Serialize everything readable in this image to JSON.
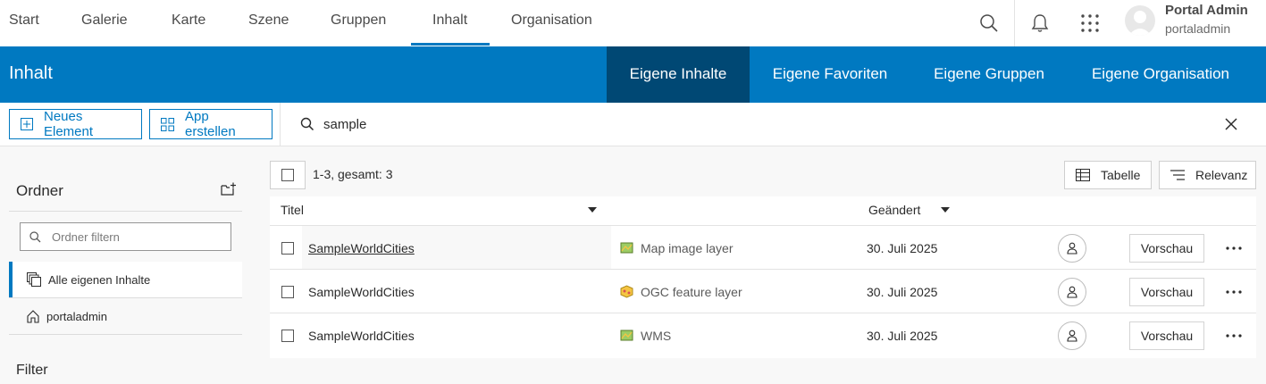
{
  "topnav": {
    "items": [
      "Start",
      "Galerie",
      "Karte",
      "Szene",
      "Gruppen",
      "Inhalt",
      "Organisation"
    ],
    "active": "Inhalt",
    "icons": [
      "search-icon",
      "bell-icon",
      "app-launcher-icon"
    ]
  },
  "user": {
    "name": "Portal Admin",
    "login": "portaladmin"
  },
  "band": {
    "title": "Inhalt",
    "tabs": [
      "Eigene Inhalte",
      "Eigene Favoriten",
      "Eigene Gruppen",
      "Eigene Organisation"
    ],
    "active": "Eigene Inhalte"
  },
  "actions": {
    "new_item": "Neues Element",
    "create_app": "App erstellen"
  },
  "search": {
    "value": "sample"
  },
  "sidebar": {
    "folders_title": "Ordner",
    "folder_filter_placeholder": "Ordner filtern",
    "folders": [
      "Alle eigenen Inhalte",
      "portaladmin"
    ],
    "selected_folder": "Alle eigenen Inhalte",
    "filter_title": "Filter"
  },
  "results": {
    "count": "1-3, gesamt: 3",
    "view_button": "Tabelle",
    "sort_button": "Relevanz"
  },
  "table": {
    "headers": {
      "title": "Titel",
      "modified": "Geändert"
    },
    "preview_label": "Vorschau",
    "rows": [
      {
        "title": "SampleWorldCities",
        "type": "Map image layer",
        "modified": "30. Juli 2025"
      },
      {
        "title": "SampleWorldCities",
        "type": "OGC feature layer",
        "modified": "30. Juli 2025"
      },
      {
        "title": "SampleWorldCities",
        "type": "WMS",
        "modified": "30. Juli 2025"
      }
    ]
  },
  "colors": {
    "brand": "#0079c1",
    "active_tab": "#004874"
  }
}
